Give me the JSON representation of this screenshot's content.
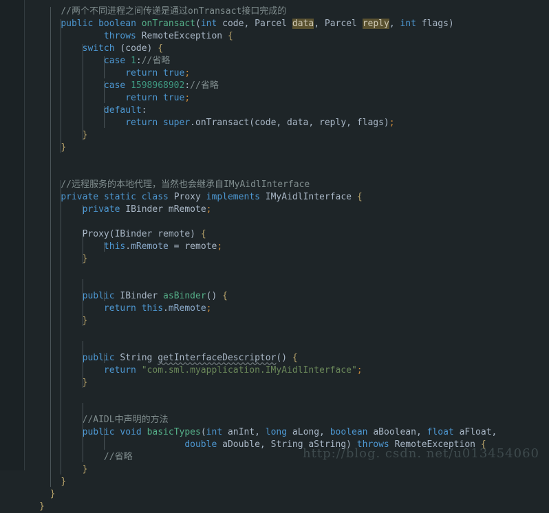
{
  "editor": {
    "background": "#1e2528",
    "gutter_background": "#1b2225",
    "gutter_separator": "#323c40",
    "language": "java",
    "font_size_px": 13,
    "line_height_px": 18
  },
  "colors": {
    "keyword_modifier": "#4d97d1",
    "identifier": "#a9b7c6",
    "method_name": "#55b089",
    "number": "#3f9a82",
    "string": "#6a8759",
    "comment": "#7f8c8d",
    "semicolon": "#c8893a",
    "brace": "#b8a36a",
    "highlight_background": "#5a5230",
    "field_reference": "#8aa9c9",
    "indent_guide": "#4a5458",
    "watermark": "#3e4a4d"
  },
  "watermark": {
    "text": "http://blog. csdn. net/u013454060"
  },
  "code": {
    "lines": [
      {
        "indent": 4,
        "tokens": [
          {
            "t": "//两个不同进程之间传递是通过onTransact接口完成的",
            "c": "cmt"
          }
        ]
      },
      {
        "indent": 4,
        "tokens": [
          {
            "t": "public",
            "c": "mod"
          },
          {
            "t": " ",
            "c": "pun"
          },
          {
            "t": "boolean",
            "c": "mod"
          },
          {
            "t": " ",
            "c": "pun"
          },
          {
            "t": "onTransact",
            "c": "fn"
          },
          {
            "t": "(",
            "c": "pun"
          },
          {
            "t": "int",
            "c": "mod"
          },
          {
            "t": " code, ",
            "c": "pun"
          },
          {
            "t": "Parcel",
            "c": "typ"
          },
          {
            "t": " ",
            "c": "pun"
          },
          {
            "t": "data",
            "c": "hl"
          },
          {
            "t": ", ",
            "c": "pun"
          },
          {
            "t": "Parcel",
            "c": "typ"
          },
          {
            "t": " ",
            "c": "pun"
          },
          {
            "t": "reply",
            "c": "hl"
          },
          {
            "t": ", ",
            "c": "pun"
          },
          {
            "t": "int",
            "c": "mod"
          },
          {
            "t": " flags)",
            "c": "pun"
          }
        ]
      },
      {
        "indent": 12,
        "tokens": [
          {
            "t": "throws",
            "c": "mod"
          },
          {
            "t": " RemoteException ",
            "c": "pun"
          },
          {
            "t": "{",
            "c": "brc"
          }
        ]
      },
      {
        "indent": 8,
        "tokens": [
          {
            "t": "switch",
            "c": "mod"
          },
          {
            "t": " (code) ",
            "c": "pun"
          },
          {
            "t": "{",
            "c": "brc"
          }
        ]
      },
      {
        "indent": 12,
        "tokens": [
          {
            "t": "case",
            "c": "mod"
          },
          {
            "t": " ",
            "c": "pun"
          },
          {
            "t": "1",
            "c": "num"
          },
          {
            "t": ":",
            "c": "pun"
          },
          {
            "t": "//省略",
            "c": "cmt"
          }
        ]
      },
      {
        "indent": 16,
        "tokens": [
          {
            "t": "return",
            "c": "mod"
          },
          {
            "t": " ",
            "c": "pun"
          },
          {
            "t": "true",
            "c": "mod"
          },
          {
            "t": ";",
            "c": "semi"
          }
        ]
      },
      {
        "indent": 12,
        "tokens": [
          {
            "t": "case",
            "c": "mod"
          },
          {
            "t": " ",
            "c": "pun"
          },
          {
            "t": "1598968902",
            "c": "num"
          },
          {
            "t": ":",
            "c": "pun"
          },
          {
            "t": "//省略",
            "c": "cmt"
          }
        ]
      },
      {
        "indent": 16,
        "tokens": [
          {
            "t": "return",
            "c": "mod"
          },
          {
            "t": " ",
            "c": "pun"
          },
          {
            "t": "true",
            "c": "mod"
          },
          {
            "t": ";",
            "c": "semi"
          }
        ]
      },
      {
        "indent": 12,
        "tokens": [
          {
            "t": "default",
            "c": "mod"
          },
          {
            "t": ":",
            "c": "pun"
          }
        ]
      },
      {
        "indent": 16,
        "tokens": [
          {
            "t": "return",
            "c": "mod"
          },
          {
            "t": " ",
            "c": "pun"
          },
          {
            "t": "super",
            "c": "mod"
          },
          {
            "t": ".onTransact(code, data, reply, flags)",
            "c": "pun"
          },
          {
            "t": ";",
            "c": "semi"
          }
        ]
      },
      {
        "indent": 8,
        "tokens": [
          {
            "t": "}",
            "c": "brc"
          }
        ]
      },
      {
        "indent": 4,
        "tokens": [
          {
            "t": "}",
            "c": "brc"
          }
        ]
      },
      {
        "indent": 0,
        "tokens": []
      },
      {
        "indent": 0,
        "tokens": []
      },
      {
        "indent": 4,
        "tokens": [
          {
            "t": "//远程服务的本地代理，当然也会继承自IMyAidlInterface",
            "c": "cmt"
          }
        ]
      },
      {
        "indent": 4,
        "tokens": [
          {
            "t": "private",
            "c": "mod"
          },
          {
            "t": " ",
            "c": "pun"
          },
          {
            "t": "static",
            "c": "mod"
          },
          {
            "t": " ",
            "c": "pun"
          },
          {
            "t": "class",
            "c": "mod"
          },
          {
            "t": " Proxy ",
            "c": "pun"
          },
          {
            "t": "implements",
            "c": "mod"
          },
          {
            "t": " IMyAidlInterface ",
            "c": "pun"
          },
          {
            "t": "{",
            "c": "brc"
          }
        ]
      },
      {
        "indent": 8,
        "tokens": [
          {
            "t": "private",
            "c": "mod"
          },
          {
            "t": " IBinder mRemote",
            "c": "pun"
          },
          {
            "t": ";",
            "c": "semi"
          }
        ]
      },
      {
        "indent": 0,
        "tokens": []
      },
      {
        "indent": 8,
        "tokens": [
          {
            "t": "Proxy(IBinder remote) ",
            "c": "pun"
          },
          {
            "t": "{",
            "c": "brc"
          }
        ]
      },
      {
        "indent": 12,
        "tokens": [
          {
            "t": "this",
            "c": "mod"
          },
          {
            "t": ".",
            "c": "pun"
          },
          {
            "t": "mRemote",
            "c": "fld"
          },
          {
            "t": " = remote",
            "c": "pun"
          },
          {
            "t": ";",
            "c": "semi"
          }
        ]
      },
      {
        "indent": 8,
        "tokens": [
          {
            "t": "}",
            "c": "brc"
          }
        ]
      },
      {
        "indent": 0,
        "tokens": []
      },
      {
        "indent": 0,
        "tokens": []
      },
      {
        "indent": 8,
        "tokens": [
          {
            "t": "public",
            "c": "mod"
          },
          {
            "t": " IBinder ",
            "c": "pun"
          },
          {
            "t": "asBinder",
            "c": "fn"
          },
          {
            "t": "() ",
            "c": "pun"
          },
          {
            "t": "{",
            "c": "brc"
          }
        ]
      },
      {
        "indent": 12,
        "tokens": [
          {
            "t": "return",
            "c": "mod"
          },
          {
            "t": " ",
            "c": "pun"
          },
          {
            "t": "this",
            "c": "mod"
          },
          {
            "t": ".",
            "c": "pun"
          },
          {
            "t": "mRemote",
            "c": "fld"
          },
          {
            "t": ";",
            "c": "semi"
          }
        ]
      },
      {
        "indent": 8,
        "tokens": [
          {
            "t": "}",
            "c": "brc"
          }
        ]
      },
      {
        "indent": 0,
        "tokens": []
      },
      {
        "indent": 0,
        "tokens": []
      },
      {
        "indent": 8,
        "tokens": [
          {
            "t": "public",
            "c": "mod"
          },
          {
            "t": " String ",
            "c": "pun"
          },
          {
            "t": "getInterfaceDescriptor",
            "c": "wavy"
          },
          {
            "t": "() ",
            "c": "pun"
          },
          {
            "t": "{",
            "c": "brc"
          }
        ]
      },
      {
        "indent": 12,
        "tokens": [
          {
            "t": "return",
            "c": "mod"
          },
          {
            "t": " ",
            "c": "pun"
          },
          {
            "t": "\"com.sml.myapplication.IMyAidlInterface\"",
            "c": "str"
          },
          {
            "t": ";",
            "c": "semi"
          }
        ]
      },
      {
        "indent": 8,
        "tokens": [
          {
            "t": "}",
            "c": "brc"
          }
        ]
      },
      {
        "indent": 0,
        "tokens": []
      },
      {
        "indent": 0,
        "tokens": []
      },
      {
        "indent": 8,
        "tokens": [
          {
            "t": "//AIDL中声明的方法",
            "c": "cmt"
          }
        ]
      },
      {
        "indent": 8,
        "tokens": [
          {
            "t": "public",
            "c": "mod"
          },
          {
            "t": " ",
            "c": "pun"
          },
          {
            "t": "void",
            "c": "mod"
          },
          {
            "t": " ",
            "c": "pun"
          },
          {
            "t": "basicTypes",
            "c": "fn"
          },
          {
            "t": "(",
            "c": "pun"
          },
          {
            "t": "int",
            "c": "mod"
          },
          {
            "t": " anInt, ",
            "c": "pun"
          },
          {
            "t": "long",
            "c": "mod"
          },
          {
            "t": " aLong, ",
            "c": "pun"
          },
          {
            "t": "boolean",
            "c": "mod"
          },
          {
            "t": " aBoolean, ",
            "c": "pun"
          },
          {
            "t": "float",
            "c": "mod"
          },
          {
            "t": " aFloat,",
            "c": "pun"
          }
        ]
      },
      {
        "indent": 27,
        "tokens": [
          {
            "t": "double",
            "c": "mod"
          },
          {
            "t": " aDouble, String aString) ",
            "c": "pun"
          },
          {
            "t": "throws",
            "c": "mod"
          },
          {
            "t": " RemoteException ",
            "c": "pun"
          },
          {
            "t": "{",
            "c": "brc"
          }
        ]
      },
      {
        "indent": 12,
        "tokens": [
          {
            "t": "//省略",
            "c": "cmt"
          }
        ]
      },
      {
        "indent": 8,
        "tokens": [
          {
            "t": "}",
            "c": "brc"
          }
        ]
      },
      {
        "indent": 4,
        "tokens": [
          {
            "t": "}",
            "c": "brc"
          }
        ]
      },
      {
        "indent": 2,
        "tokens": [
          {
            "t": "}",
            "c": "brc"
          }
        ]
      },
      {
        "indent": 0,
        "tokens": [
          {
            "t": "}",
            "c": "brc"
          }
        ]
      }
    ],
    "indent_guides": [
      {
        "col": 4,
        "from_line": 1,
        "to_line": 11
      },
      {
        "col": 8,
        "from_line": 3,
        "to_line": 10
      },
      {
        "col": 12,
        "from_line": 4,
        "to_line": 5
      },
      {
        "col": 12,
        "from_line": 6,
        "to_line": 7
      },
      {
        "col": 12,
        "from_line": 8,
        "to_line": 9
      },
      {
        "col": 4,
        "from_line": 14,
        "to_line": 37
      },
      {
        "col": 8,
        "from_line": 16,
        "to_line": 16
      },
      {
        "col": 8,
        "from_line": 18,
        "to_line": 20
      },
      {
        "col": 8,
        "from_line": 22,
        "to_line": 25
      },
      {
        "col": 8,
        "from_line": 27,
        "to_line": 30
      },
      {
        "col": 8,
        "from_line": 32,
        "to_line": 36
      },
      {
        "col": 12,
        "from_line": 19,
        "to_line": 19
      },
      {
        "col": 12,
        "from_line": 23,
        "to_line": 23
      },
      {
        "col": 12,
        "from_line": 28,
        "to_line": 28
      },
      {
        "col": 12,
        "from_line": 34,
        "to_line": 35
      },
      {
        "col": 2,
        "from_line": 0,
        "to_line": 38
      }
    ]
  }
}
